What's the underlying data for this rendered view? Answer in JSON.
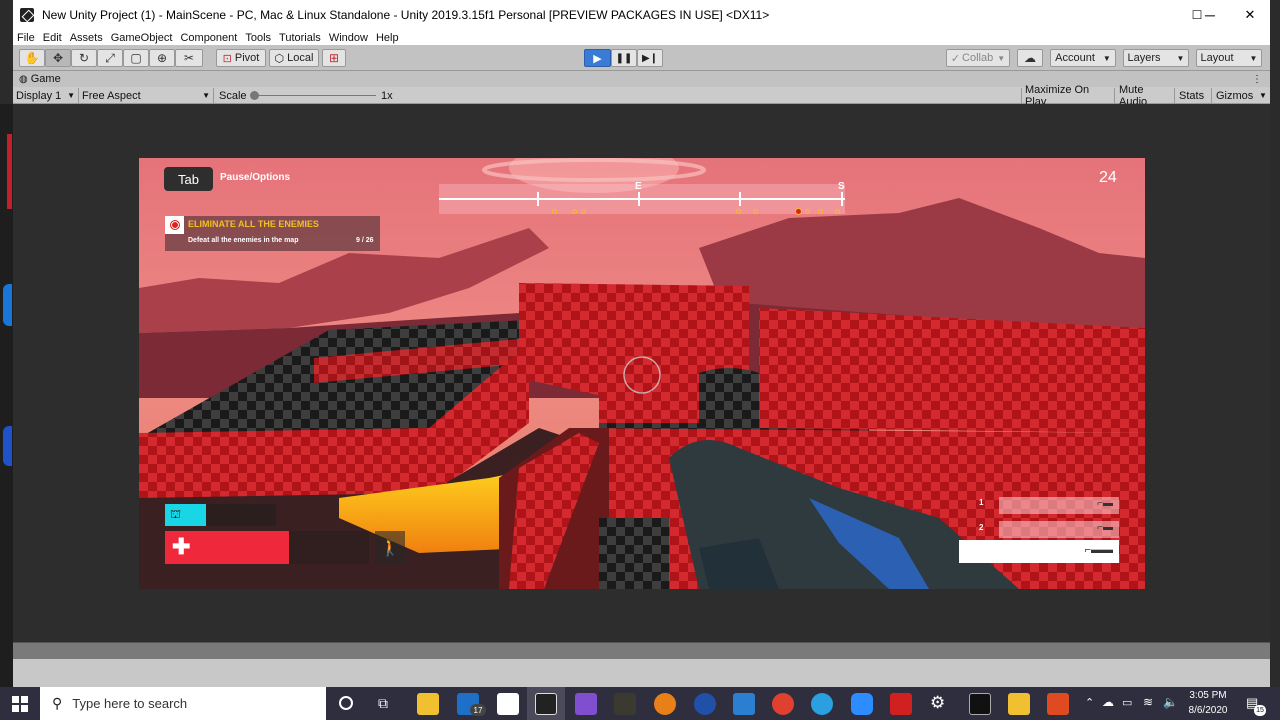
{
  "window": {
    "title": "New Unity Project (1) - MainScene - PC, Mac & Linux Standalone - Unity 2019.3.15f1 Personal [PREVIEW PACKAGES IN USE] <DX11>",
    "minimize": "─",
    "maximize": "☐",
    "close": "✕"
  },
  "menu": [
    "File",
    "Edit",
    "Assets",
    "GameObject",
    "Component",
    "Tools",
    "Tutorials",
    "Window",
    "Help"
  ],
  "toolbar": {
    "pivot": "Pivot",
    "local": "Local",
    "collab": "Collab",
    "account": "Account",
    "layers": "Layers",
    "layout": "Layout"
  },
  "game_tab": {
    "label": "Game",
    "display": "Display 1",
    "aspect": "Free Aspect",
    "scale_label": "Scale",
    "scale_value": "1x",
    "maximize_on_play": "Maximize On Play",
    "mute_audio": "Mute Audio",
    "stats": "Stats",
    "gizmos": "Gizmos"
  },
  "hud": {
    "tab_key": "Tab",
    "pause_options": "Pause/Options",
    "compass_e": "E",
    "compass_s": "S",
    "counter": "24",
    "objective_title": "ELIMINATE ALL THE ENEMIES",
    "objective_sub": "Defeat all the enemies in the map",
    "objective_progress": "9 / 26",
    "weapon_1": "1",
    "weapon_2": "2",
    "health_fraction": 0.61,
    "jetpack_fraction": 0.37
  },
  "taskbar": {
    "search_placeholder": "Type here to search",
    "time": "3:05 PM",
    "date": "8/6/2020",
    "mail_badge": "17",
    "notif_badge": "15"
  },
  "colors": {
    "accent_blue": "#3a7bd5",
    "health_red": "#f0283c",
    "jetpack_cyan": "#18d6e6",
    "objective_yellow": "#f0c020"
  }
}
